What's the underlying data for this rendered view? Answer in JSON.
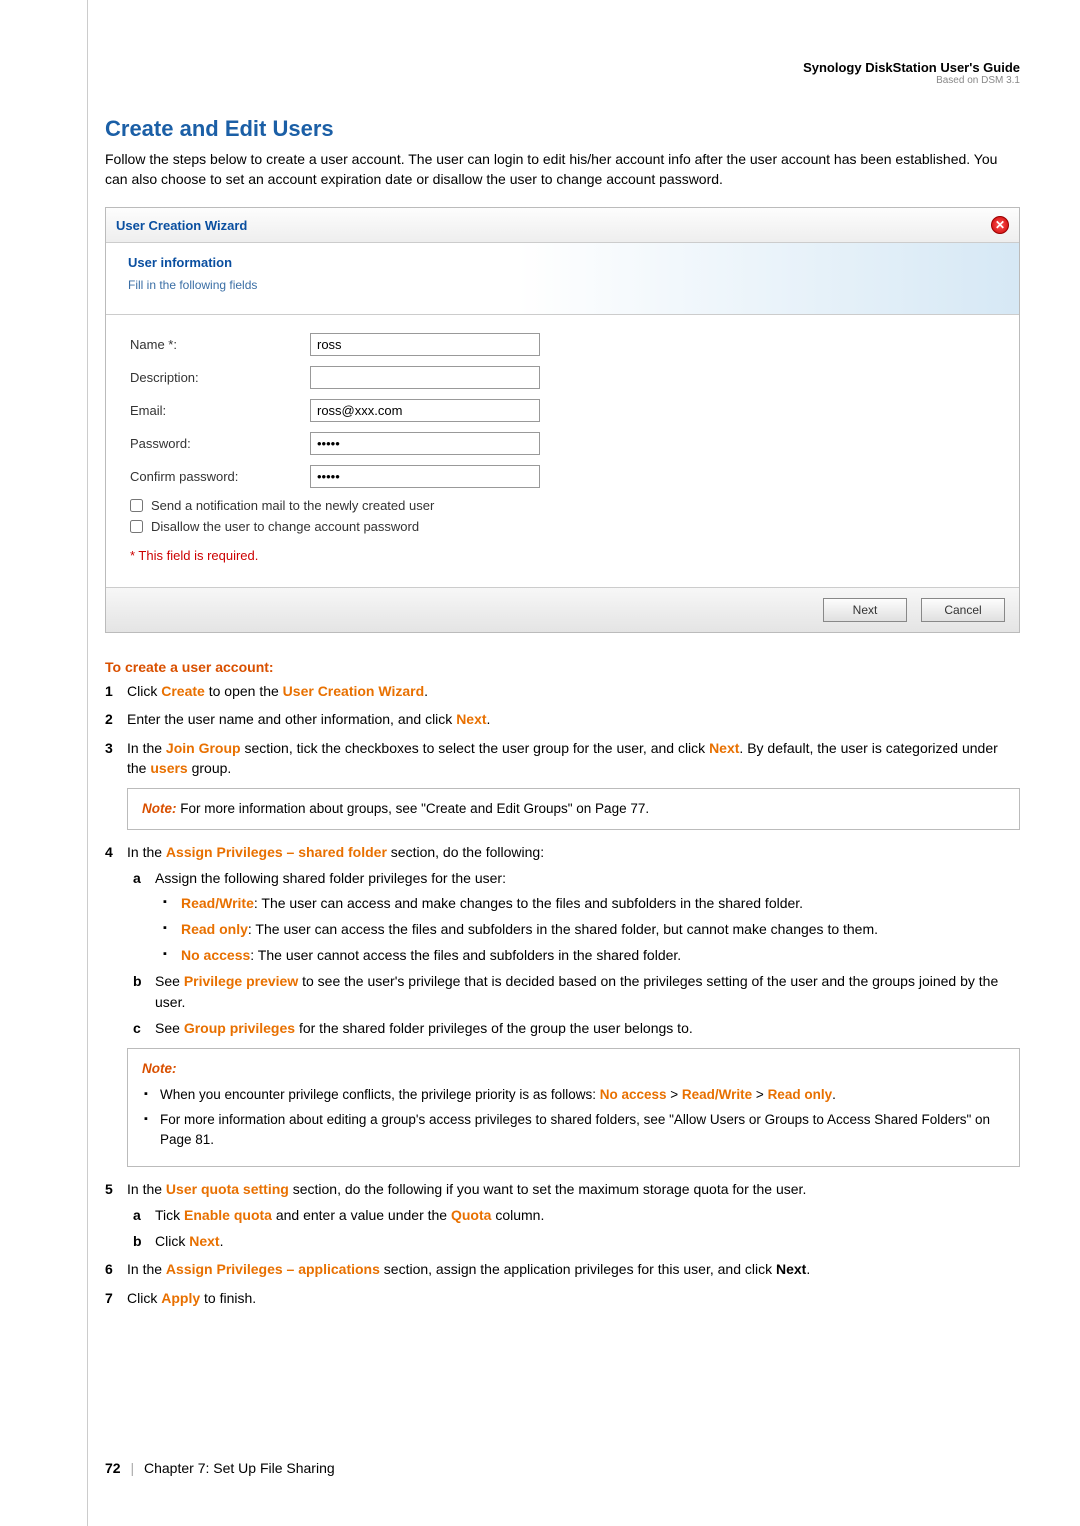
{
  "header": {
    "title": "Synology DiskStation User's Guide",
    "subtitle": "Based on DSM 3.1"
  },
  "section": {
    "title": "Create and Edit Users",
    "intro": "Follow the steps below to create a user account. The user can login to edit his/her account info after the user account has been established. You can also choose to set an account expiration date or disallow the user to change account password."
  },
  "wizard": {
    "window_title": "User Creation Wizard",
    "header_title": "User information",
    "header_sub": "Fill in the following fields",
    "fields": {
      "name_label": "Name *:",
      "name_value": "ross",
      "description_label": "Description:",
      "description_value": "",
      "email_label": "Email:",
      "email_value": "ross@xxx.com",
      "password_label": "Password:",
      "password_value": "•••••",
      "confirm_label": "Confirm password:",
      "confirm_value": "•••••"
    },
    "checks": {
      "notify": "Send a notification mail to the newly created user",
      "disallow": "Disallow the user to change account password"
    },
    "required_note": "* This field is required.",
    "buttons": {
      "next": "Next",
      "cancel": "Cancel"
    }
  },
  "instructions": {
    "heading": "To create a user account:",
    "step1_a": "Click ",
    "step1_b": "Create",
    "step1_c": " to open the ",
    "step1_d": "User Creation Wizard",
    "step1_e": ".",
    "step2_a": "Enter the user name and other information, and click ",
    "step2_b": "Next",
    "step2_c": ".",
    "step3_a": "In the ",
    "step3_b": "Join Group",
    "step3_c": " section, tick the checkboxes to select the user group for the user, and click ",
    "step3_d": "Next",
    "step3_e": ". By default, the user is categorized under the ",
    "step3_f": "users",
    "step3_g": " group.",
    "note1_label": "Note:",
    "note1_text": " For more information about groups, see \"Create and Edit Groups\" on Page 77.",
    "step4_a": "In the ",
    "step4_b": "Assign Privileges – shared folder",
    "step4_c": " section, do the following:",
    "step4_sub_a": "Assign the following shared folder privileges for the user:",
    "rw_label": "Read/Write",
    "rw_text": ": The user can access and make changes to the files and subfolders in the shared folder.",
    "ro_label": "Read only",
    "ro_text": ": The user can access the files and subfolders in the shared folder, but cannot make changes to them.",
    "na_label": "No access",
    "na_text": ": The user cannot access the files and subfolders in the shared folder.",
    "step4_sub_b_a": "See ",
    "step4_sub_b_b": "Privilege preview",
    "step4_sub_b_c": " to see the user's privilege that is decided based on the privileges setting of the user and the groups joined by the user.",
    "step4_sub_c_a": "See ",
    "step4_sub_c_b": "Group privileges",
    "step4_sub_c_c": " for the shared folder privileges of the group the user belongs to.",
    "note2_label": "Note:",
    "note2_b1_a": "When you encounter privilege conflicts, the privilege priority is as follows: ",
    "note2_b1_b": "No access",
    "note2_b1_c": " > ",
    "note2_b1_d": "Read/Write",
    "note2_b1_e": " > ",
    "note2_b1_f": "Read only",
    "note2_b1_g": ".",
    "note2_b2": "For more information about editing a group's access privileges to shared folders, see \"Allow Users or Groups to Access Shared Folders\" on Page 81.",
    "step5_a": "In the ",
    "step5_b": "User quota setting",
    "step5_c": " section, do the following if you want to set the maximum storage quota for the user.",
    "step5_sub_a_a": "Tick ",
    "step5_sub_a_b": "Enable quota",
    "step5_sub_a_c": " and enter a value under the ",
    "step5_sub_a_d": "Quota",
    "step5_sub_a_e": " column.",
    "step5_sub_b_a": "Click ",
    "step5_sub_b_b": "Next",
    "step5_sub_b_c": ".",
    "step6_a": "In the ",
    "step6_b": "Assign Privileges – applications",
    "step6_c": " section, assign the application privileges for this user, and click ",
    "step6_d": "Next",
    "step6_e": ".",
    "step7_a": "Click ",
    "step7_b": "Apply",
    "step7_c": " to finish."
  },
  "footer": {
    "page": "72",
    "chapter": "Chapter 7: Set Up File Sharing"
  }
}
